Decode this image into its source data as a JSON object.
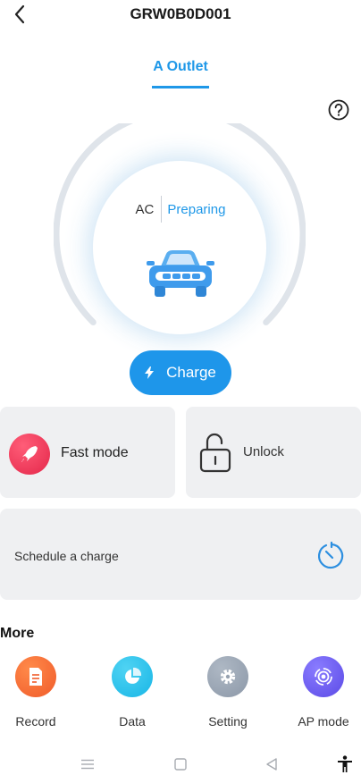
{
  "header": {
    "title": "GRW0B0D001"
  },
  "tabs": [
    {
      "label": "A Outlet",
      "active": true
    }
  ],
  "status": {
    "type": "AC",
    "state": "Preparing"
  },
  "actions": {
    "charge_label": "Charge"
  },
  "cards": {
    "fast_mode": {
      "label": "Fast mode"
    },
    "unlock": {
      "label": "Unlock"
    },
    "schedule": {
      "label": "Schedule a charge"
    }
  },
  "more": {
    "heading": "More",
    "items": [
      {
        "label": "Record",
        "icon": "record-icon"
      },
      {
        "label": "Data",
        "icon": "pie-chart-icon"
      },
      {
        "label": "Setting",
        "icon": "gear-icon"
      },
      {
        "label": "AP mode",
        "icon": "signal-icon"
      }
    ]
  },
  "colors": {
    "accent": "#1f98e8",
    "fast_mode": "#e93355",
    "record": "#f4682f",
    "data": "#27c0ec",
    "setting": "#97a2b0",
    "ap_mode": "#6b5bf0"
  }
}
